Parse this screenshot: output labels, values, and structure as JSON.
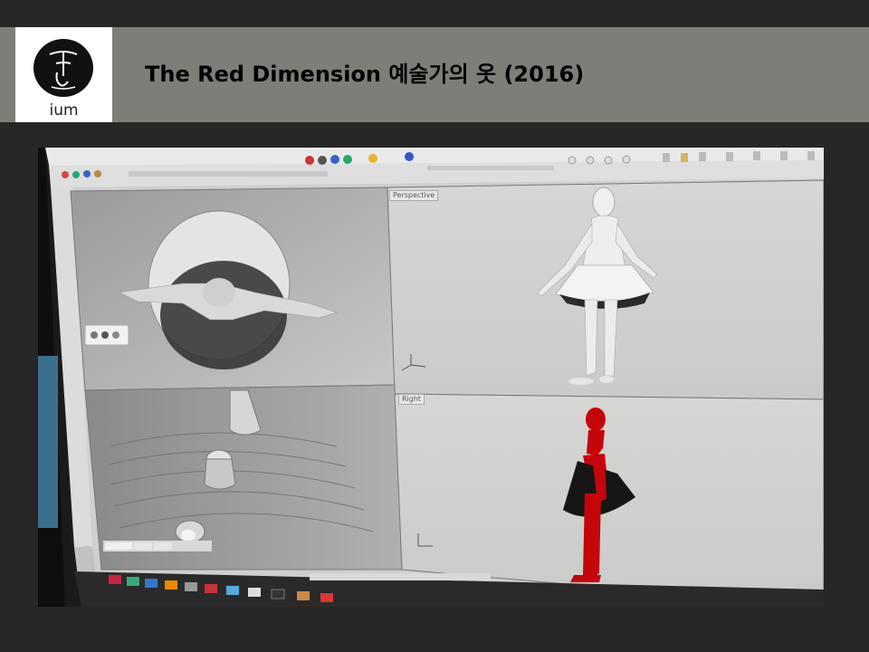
{
  "header": {
    "logo_text": "ium",
    "title": "The Red Dimension 예술가의 옷 (2016)"
  },
  "photo": {
    "viewports": {
      "perspective_label": "Perspective",
      "right_label": "Right"
    }
  },
  "colors": {
    "header_band": "#7e7e79",
    "background": "#262626",
    "figure_red": "#c4060a"
  },
  "icons": [
    "ium-logo-icon"
  ]
}
